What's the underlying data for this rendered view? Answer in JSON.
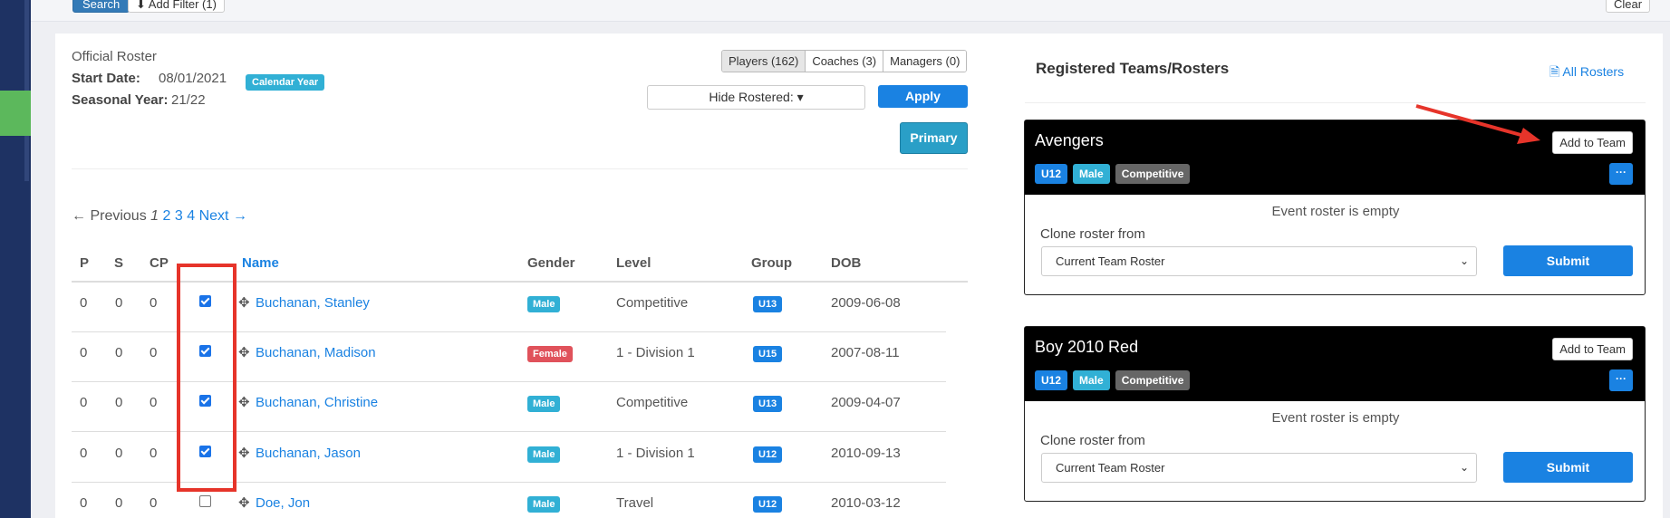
{
  "top": {
    "search_label": "Search",
    "filter_label": "Add Filter (1)",
    "clear_label": "Clear"
  },
  "roster": {
    "heading": "Official Roster",
    "start_date_label": "Start Date:",
    "start_date_value": "08/01/2021",
    "calendar_badge": "Calendar Year",
    "seasonal_label": "Seasonal Year:",
    "seasonal_value": "21/22",
    "tabs": [
      "Players (162)",
      "Coaches (3)",
      "Managers (0)"
    ],
    "hide_rostered": "Hide Rostered:",
    "apply_label": "Apply",
    "primary_label": "Primary"
  },
  "pager": {
    "prev": "← Previous",
    "current": "1",
    "pages": [
      "2",
      "3",
      "4"
    ],
    "next": "Next →"
  },
  "table": {
    "headers": {
      "p": "P",
      "s": "S",
      "cp": "CP",
      "name": "Name",
      "gender": "Gender",
      "level": "Level",
      "group": "Group",
      "dob": "DOB"
    },
    "rows": [
      {
        "p": "0",
        "s": "0",
        "cp": "0",
        "checked": true,
        "name": "Buchanan, Stanley",
        "gender": "Male",
        "level": "Competitive",
        "group": "U13",
        "dob": "2009-06-08"
      },
      {
        "p": "0",
        "s": "0",
        "cp": "0",
        "checked": true,
        "name": "Buchanan, Madison",
        "gender": "Female",
        "level": "1 - Division 1",
        "group": "U15",
        "dob": "2007-08-11"
      },
      {
        "p": "0",
        "s": "0",
        "cp": "0",
        "checked": true,
        "name": "Buchanan, Christine",
        "gender": "Male",
        "level": "Competitive",
        "group": "U13",
        "dob": "2009-04-07"
      },
      {
        "p": "0",
        "s": "0",
        "cp": "0",
        "checked": true,
        "name": "Buchanan, Jason",
        "gender": "Male",
        "level": "1 - Division 1",
        "group": "U12",
        "dob": "2010-09-13"
      },
      {
        "p": "0",
        "s": "0",
        "cp": "0",
        "checked": false,
        "name": "Doe, Jon",
        "gender": "Male",
        "level": "Travel",
        "group": "U12",
        "dob": "2010-03-12"
      }
    ]
  },
  "registered": {
    "title": "Registered Teams/Rosters",
    "all_rosters": "All Rosters",
    "teams": [
      {
        "name": "Avengers",
        "add_label": "Add to Team",
        "tags": [
          "U12",
          "Male",
          "Competitive"
        ],
        "empty": "Event roster is empty",
        "clone_label": "Clone roster from",
        "clone_value": "Current Team Roster",
        "submit_label": "Submit"
      },
      {
        "name": "Boy 2010 Red",
        "add_label": "Add to Team",
        "tags": [
          "U12",
          "Male",
          "Competitive"
        ],
        "empty": "Event roster is empty",
        "clone_label": "Clone roster from",
        "clone_value": "Current Team Roster",
        "submit_label": "Submit"
      }
    ]
  },
  "colors": {
    "brand_blue": "#1a82e2",
    "annotation_red": "#e6342a",
    "nav_dark": "#1e3263"
  }
}
